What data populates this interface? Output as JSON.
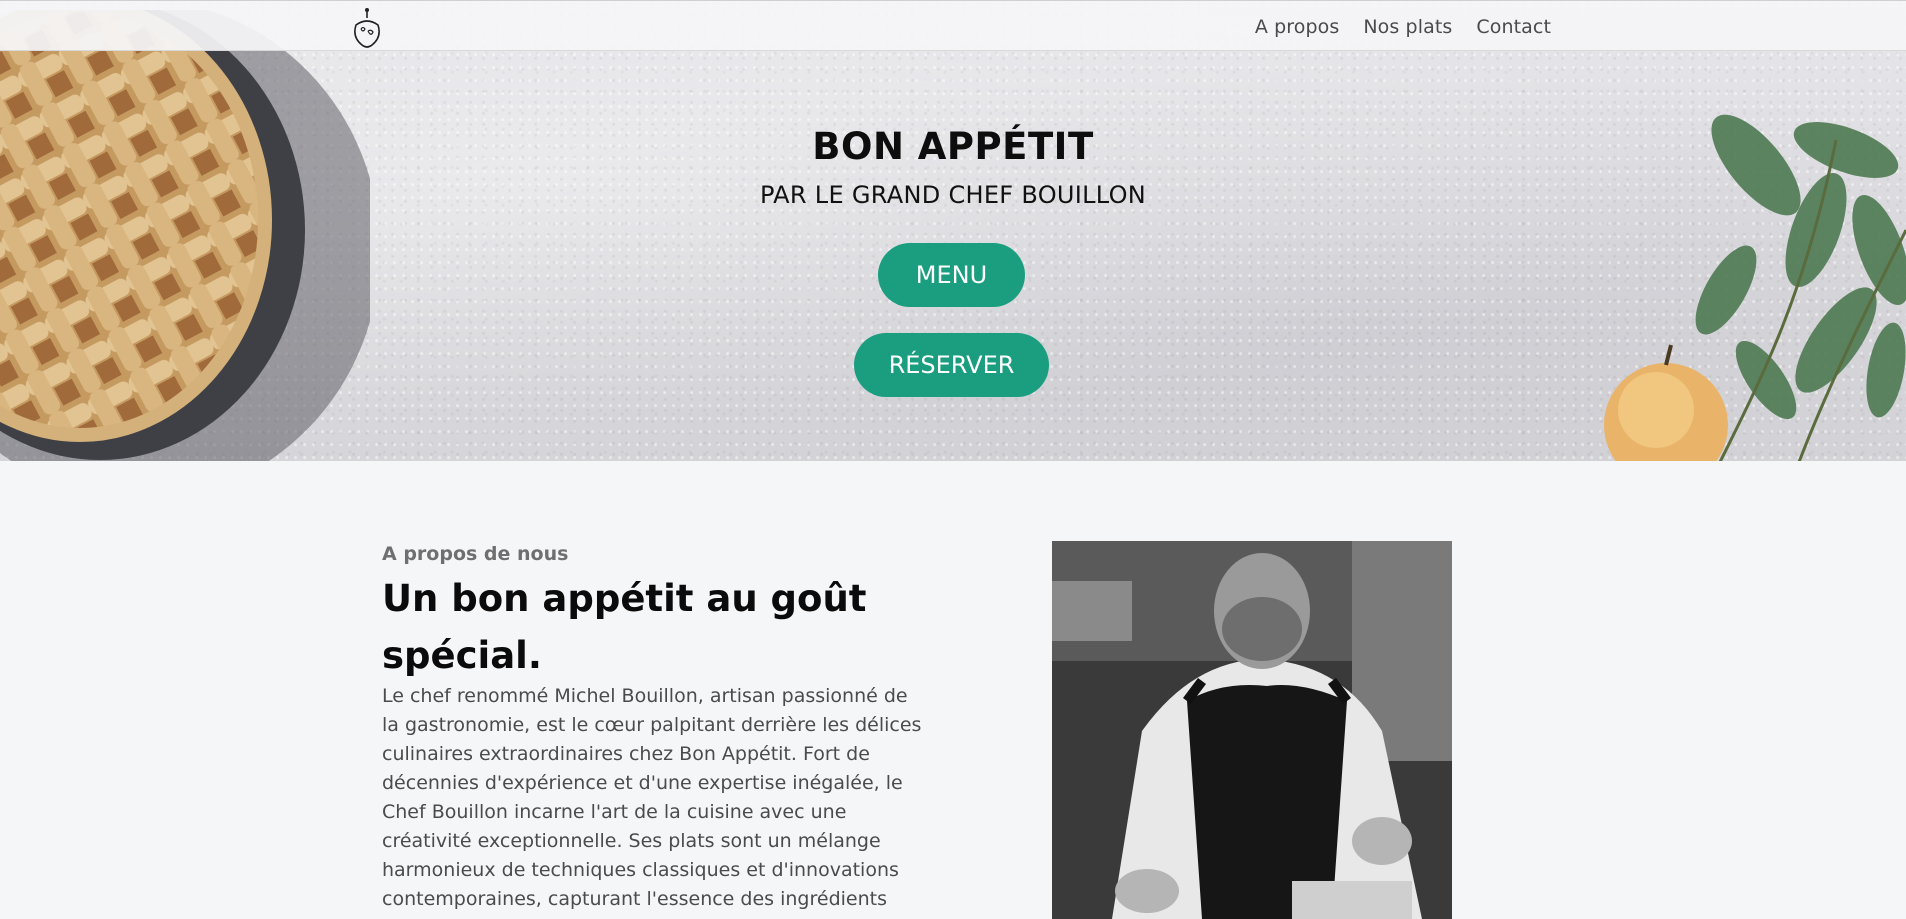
{
  "nav": {
    "logo": "chef-logo",
    "links": [
      "A propos",
      "Nos plats",
      "Contact"
    ]
  },
  "hero": {
    "title": "BON APPÉTIT",
    "subtitle": "PAR LE GRAND CHEF BOUILLON",
    "menu_button": "MENU",
    "reserve_button": "RÉSERVER"
  },
  "about": {
    "kicker": "A propos de nous",
    "heading": "Un bon appétit au goût spécial.",
    "text": "Le chef renommé Michel Bouillon, artisan passionné de la gastronomie, est le cœur palpitant derrière les délices culinaires extraordinaires chez Bon Appétit. Fort de décennies d'expérience et d'une expertise inégalée, le Chef Bouillon incarne l'art de la cuisine avec une créativité exceptionnelle. Ses plats sont un mélange harmonieux de techniques classiques et d'innovations contemporaines, capturant l'essence des ingrédients"
  },
  "colors": {
    "accent": "#1a9e7f",
    "background": "#f5f6f8",
    "nav_text": "#4a4a4a"
  }
}
